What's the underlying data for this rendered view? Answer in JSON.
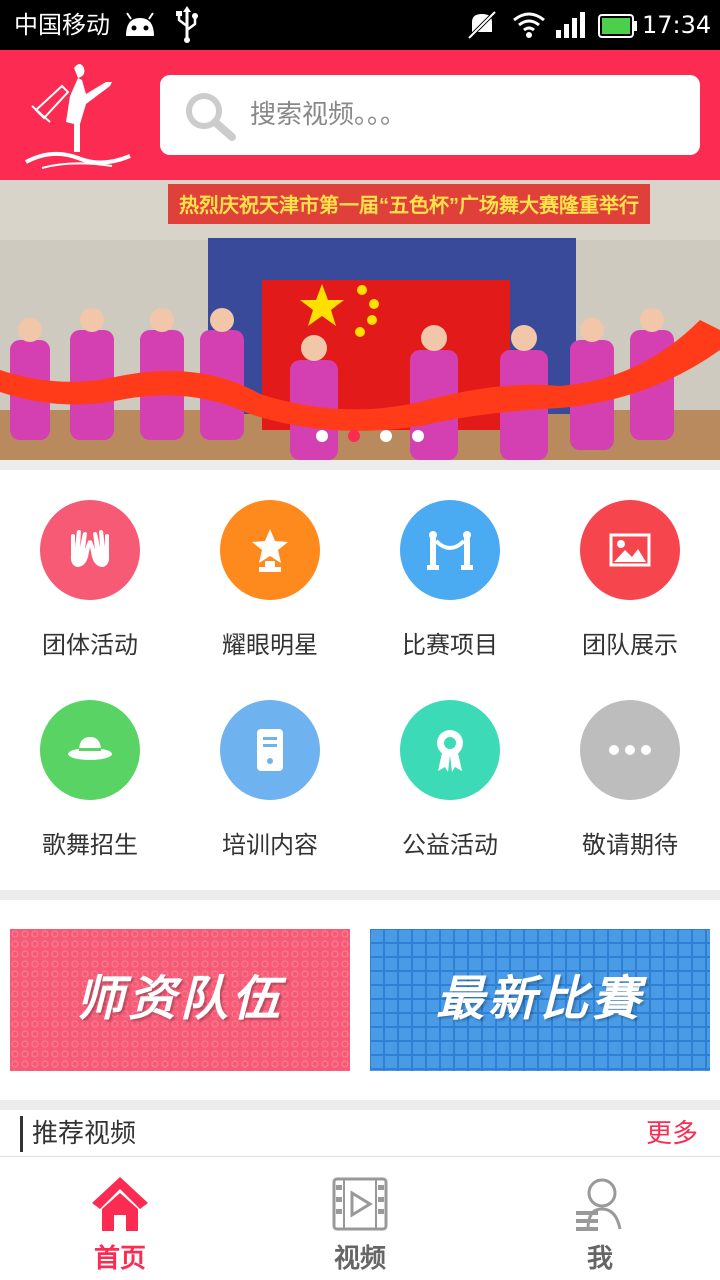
{
  "status_bar": {
    "carrier": "中国移动",
    "time": "17:34",
    "icons": [
      "android-icon",
      "usb-icon",
      "mute-icon",
      "wifi-icon",
      "signal-icon",
      "battery-icon"
    ]
  },
  "header": {
    "logo_icon": "dancer-logo-icon",
    "search_placeholder": "搜索视频。。。",
    "brand_color": "#fb2b52"
  },
  "banner": {
    "image_caption": "热烈庆祝天津市第一届“五色杯”广场舞大赛隆重举行",
    "slides_count": 4,
    "active_slide": 2
  },
  "categories": [
    {
      "label": "团体活动",
      "icon": "hands-icon",
      "color": "#f65a75"
    },
    {
      "label": "耀眼明星",
      "icon": "trophy-star-icon",
      "color": "#fe8a1e"
    },
    {
      "label": "比赛项目",
      "icon": "stanchion-icon",
      "color": "#4aabf3"
    },
    {
      "label": "团队展示",
      "icon": "picture-icon",
      "color": "#f6454d"
    },
    {
      "label": "歌舞招生",
      "icon": "hat-icon",
      "color": "#59d464"
    },
    {
      "label": "培训内容",
      "icon": "document-icon",
      "color": "#6fb2f0"
    },
    {
      "label": "公益活动",
      "icon": "medal-icon",
      "color": "#3ddab8"
    },
    {
      "label": "敬请期待",
      "icon": "more-dots-icon",
      "color": "#bdbdbd"
    }
  ],
  "promos": [
    {
      "label": "师资队伍",
      "color": "#f65a75"
    },
    {
      "label": "最新比賽",
      "color": "#3f8fe0"
    }
  ],
  "section": {
    "title": "推荐视频",
    "more": "更多"
  },
  "bottom_nav": [
    {
      "label": "首页",
      "icon": "home-icon",
      "active": true
    },
    {
      "label": "视频",
      "icon": "video-icon",
      "active": false
    },
    {
      "label": "我",
      "icon": "profile-icon",
      "active": false
    }
  ]
}
